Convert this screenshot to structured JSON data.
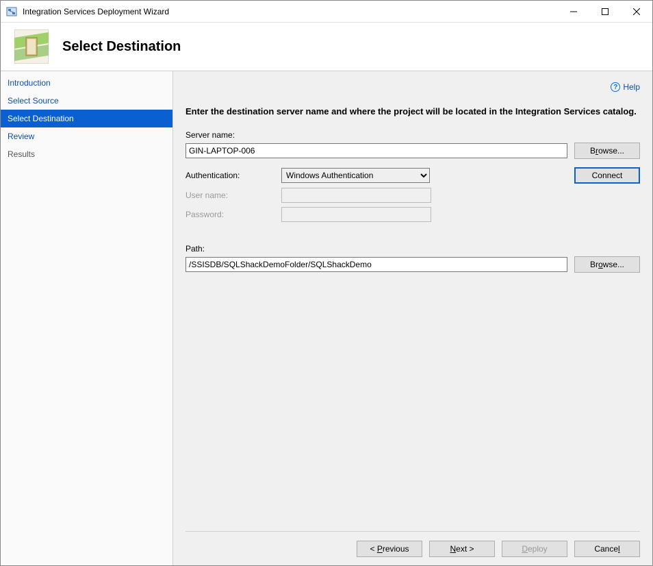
{
  "window": {
    "title": "Integration Services Deployment Wizard"
  },
  "header": {
    "title": "Select Destination"
  },
  "sidebar": {
    "items": [
      {
        "label": "Introduction",
        "selected": false,
        "disabled": false
      },
      {
        "label": "Select Source",
        "selected": false,
        "disabled": false
      },
      {
        "label": "Select Destination",
        "selected": true,
        "disabled": false
      },
      {
        "label": "Review",
        "selected": false,
        "disabled": false
      },
      {
        "label": "Results",
        "selected": false,
        "disabled": true
      }
    ]
  },
  "content": {
    "help_label": "Help",
    "intro": "Enter the destination server name and where the project will be located in the Integration Services catalog.",
    "server_name_label": "Server name:",
    "server_name_value": "GIN-LAPTOP-006",
    "browse_label": "Browse...",
    "authentication_label": "Authentication:",
    "authentication_value": "Windows Authentication",
    "connect_label": "Connect",
    "user_name_label": "User name:",
    "password_label": "Password:",
    "path_label": "Path:",
    "path_value": "/SSISDB/SQLShackDemoFolder/SQLShackDemo"
  },
  "footer": {
    "previous": "Previous",
    "next": "Next >",
    "deploy": "Deploy",
    "cancel": "Cancel"
  }
}
